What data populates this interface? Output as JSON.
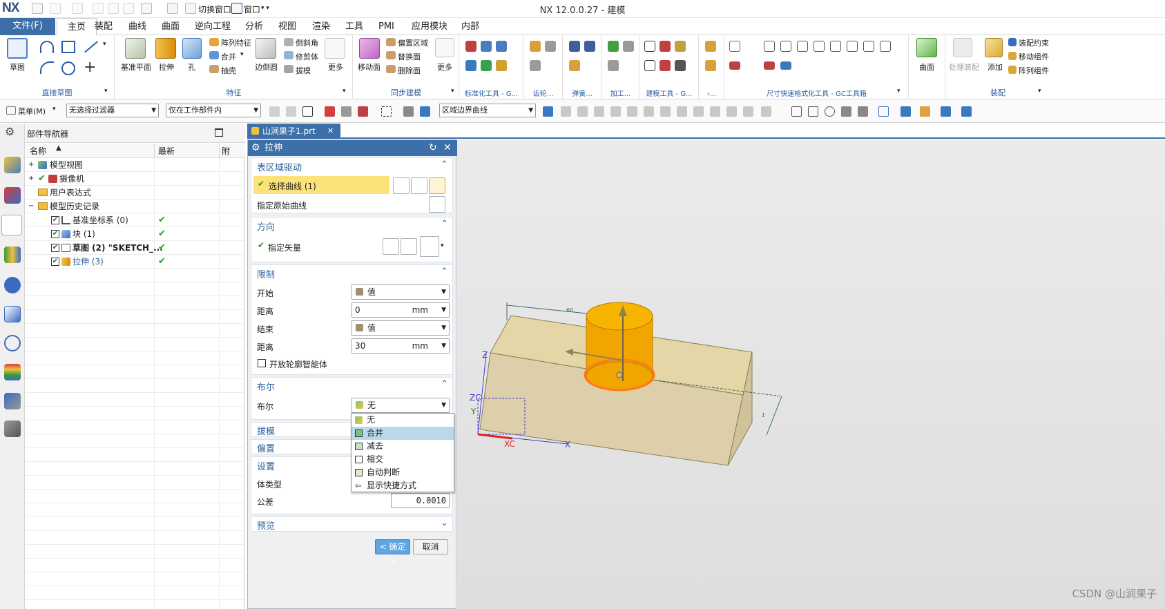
{
  "titlebar": {
    "logo": "NX",
    "title": "NX 12.0.0.27 - 建模",
    "switch_window": "切换窗口",
    "window_menu": "窗口"
  },
  "menubar": {
    "file": "文件(F)",
    "tabs": [
      "主页",
      "装配",
      "曲线",
      "曲面",
      "逆向工程",
      "分析",
      "视图",
      "渲染",
      "工具",
      "PMI",
      "应用模块",
      "内部"
    ]
  },
  "ribbon": {
    "direct_sketch": {
      "label": "直接草图",
      "sketch": "草图"
    },
    "feature": {
      "label": "特征",
      "datum_plane": "基准平面",
      "extrude": "拉伸",
      "hole": "孔",
      "pattern_feature": "阵列特征",
      "unite": "合并",
      "shell": "抽壳",
      "edge_blend": "边倒圆",
      "chamfer": "倒斜角",
      "trim_body": "修剪体",
      "draft": "拔模",
      "more": "更多"
    },
    "sync": {
      "label": "同步建模",
      "move_face": "移动面",
      "offset_region": "偏置区域",
      "replace": "替换面",
      "delete_face": "删除面",
      "more": "更多"
    },
    "std_tools": "标准化工具 - G...",
    "gear": "齿轮...",
    "spring": "弹簧...",
    "machining": "加工...",
    "build_tools": "建模工具 - G...",
    "more_dots": "›...",
    "dim_tools": "尺寸快速格式化工具 - GC工具箱",
    "surface": "曲面",
    "assembly": {
      "label": "装配",
      "process_assembly": "处理装配",
      "add": "添加",
      "constraint": "装配约束",
      "move_component": "移动组件",
      "pattern_component": "阵列组件"
    }
  },
  "toolbar2": {
    "menu": "菜单(M)",
    "filter": "无选择过滤器",
    "scope": "仅在工作部件内",
    "curve_rule": "区域边界曲线"
  },
  "navigator": {
    "title": "部件导航器",
    "col_name": "名称",
    "col_latest": "最新",
    "col_extra": "附",
    "rows": [
      "模型视图",
      "摄像机",
      "用户表达式",
      "模型历史记录",
      "基准坐标系 (0)",
      "块 (1)",
      "草图 (2) \"SKETCH_...",
      "拉伸 (3)"
    ]
  },
  "doc_tab": "山涧果子1.prt",
  "dialog": {
    "title": "拉伸",
    "sec_section": "表区域驱动",
    "select_curve": "选择曲线 (1)",
    "specify_origin": "指定原始曲线",
    "sec_direction": "方向",
    "specify_vector": "指定矢量",
    "sec_limits": "限制",
    "start": "开始",
    "start_value": "值",
    "distance": "距离",
    "start_distance": "0",
    "unit": "mm",
    "end": "结束",
    "end_value": "值",
    "end_distance": "30",
    "open_profile": "开放轮廓智能体",
    "sec_boolean": "布尔",
    "boolean_label": "布尔",
    "boolean_value": "无",
    "boolean_options": [
      "无",
      "合并",
      "减去",
      "相交",
      "自动判断",
      "显示快捷方式"
    ],
    "sec_draft": "拔模",
    "sec_offset": "偏置",
    "sec_settings": "设置",
    "body_type": "体类型",
    "tolerance": "公差",
    "tolerance_value": "0.0010",
    "sec_preview": "预览",
    "ok": "< 确定 >",
    "cancel": "取消"
  },
  "viewport": {
    "axis_zc": "ZC",
    "axis_xc": "XC",
    "axis_x": "X",
    "axis_y": "Y",
    "axis_z": "Z",
    "dim_60": "60",
    "watermark": "CSDN @山涧果子"
  },
  "colors": {
    "accent": "#3d6fa8",
    "highlight": "#fde27a",
    "cylinder": "#f0a500",
    "block": "#e8d8a8"
  }
}
